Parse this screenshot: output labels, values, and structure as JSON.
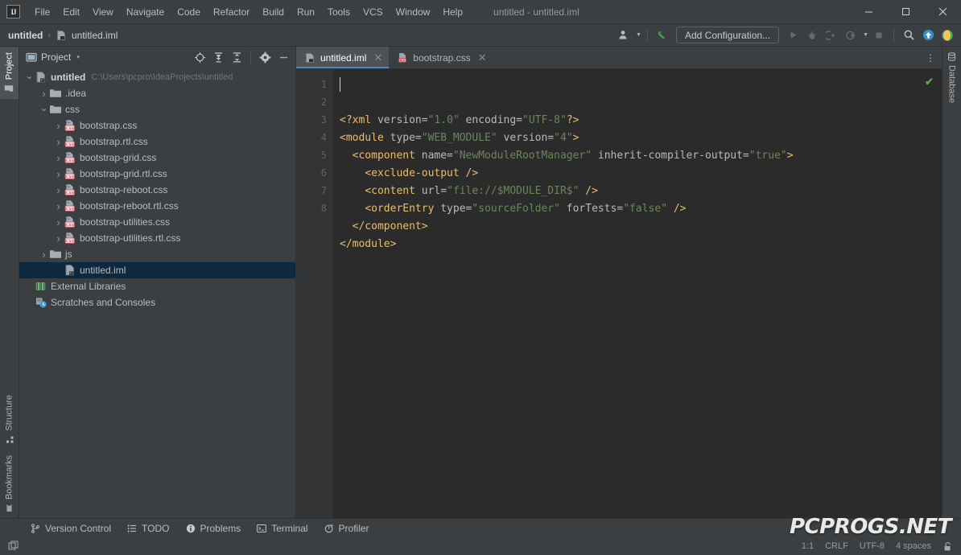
{
  "window": {
    "title": "untitled - untitled.iml",
    "minimize_label": "─",
    "maximize_label": "☐",
    "close_label": "✕"
  },
  "menu": {
    "logo": "IJ",
    "items": [
      {
        "label": "File"
      },
      {
        "label": "Edit"
      },
      {
        "label": "View"
      },
      {
        "label": "Navigate"
      },
      {
        "label": "Code"
      },
      {
        "label": "Refactor"
      },
      {
        "label": "Build"
      },
      {
        "label": "Run"
      },
      {
        "label": "Tools"
      },
      {
        "label": "VCS"
      },
      {
        "label": "Window"
      },
      {
        "label": "Help"
      }
    ]
  },
  "navbar": {
    "breadcrumb": [
      {
        "label": "untitled"
      },
      {
        "label": "untitled.iml"
      }
    ],
    "separator": "›",
    "add_configuration": "Add Configuration...",
    "icons": [
      "user-avatar-icon",
      "chevron-down-icon",
      "vcs-update-arrow-icon",
      "run-icon",
      "debug-icon",
      "run-coverage-icon",
      "profile-icon",
      "chevron-down-icon",
      "stop-icon",
      "search-icon",
      "update-icon",
      "ide-feature-icon"
    ]
  },
  "left_strip": {
    "tabs": [
      {
        "label": "Project",
        "icon": "project-folder-icon",
        "active": true
      },
      {
        "label": "Structure",
        "icon": "structure-icon",
        "active": false
      },
      {
        "label": "Bookmarks",
        "icon": "bookmarks-icon",
        "active": false
      }
    ],
    "bottom_icon": "layout-windows-icon"
  },
  "right_strip": {
    "tabs": [
      {
        "label": "Database",
        "icon": "database-icon",
        "active": false
      }
    ]
  },
  "project_panel": {
    "title": "Project",
    "title_caret": "▾",
    "toolbar_icons": [
      "locate-target-icon",
      "expand-all-icon",
      "collapse-all-icon",
      "settings-gear-icon",
      "minimize-icon"
    ],
    "tree": [
      {
        "indent": 0,
        "arrow": "down",
        "icon": "module-icon",
        "label": "untitled",
        "bold": true,
        "path": "C:\\Users\\pcpro\\IdeaProjects\\untitled",
        "selected": false
      },
      {
        "indent": 1,
        "arrow": "right",
        "icon": "folder-icon",
        "label": ".idea",
        "bold": false,
        "path": "",
        "selected": false
      },
      {
        "indent": 1,
        "arrow": "down",
        "icon": "folder-icon",
        "label": "css",
        "bold": false,
        "path": "",
        "selected": false
      },
      {
        "indent": 2,
        "arrow": "right",
        "icon": "css-file-icon",
        "label": "bootstrap.css",
        "bold": false,
        "path": "",
        "selected": false
      },
      {
        "indent": 2,
        "arrow": "right",
        "icon": "css-file-icon",
        "label": "bootstrap.rtl.css",
        "bold": false,
        "path": "",
        "selected": false
      },
      {
        "indent": 2,
        "arrow": "right",
        "icon": "css-file-icon",
        "label": "bootstrap-grid.css",
        "bold": false,
        "path": "",
        "selected": false
      },
      {
        "indent": 2,
        "arrow": "right",
        "icon": "css-file-icon",
        "label": "bootstrap-grid.rtl.css",
        "bold": false,
        "path": "",
        "selected": false
      },
      {
        "indent": 2,
        "arrow": "right",
        "icon": "css-file-icon",
        "label": "bootstrap-reboot.css",
        "bold": false,
        "path": "",
        "selected": false
      },
      {
        "indent": 2,
        "arrow": "right",
        "icon": "css-file-icon",
        "label": "bootstrap-reboot.rtl.css",
        "bold": false,
        "path": "",
        "selected": false
      },
      {
        "indent": 2,
        "arrow": "right",
        "icon": "css-file-icon",
        "label": "bootstrap-utilities.css",
        "bold": false,
        "path": "",
        "selected": false
      },
      {
        "indent": 2,
        "arrow": "right",
        "icon": "css-file-icon",
        "label": "bootstrap-utilities.rtl.css",
        "bold": false,
        "path": "",
        "selected": false
      },
      {
        "indent": 1,
        "arrow": "right",
        "icon": "folder-icon",
        "label": "js",
        "bold": false,
        "path": "",
        "selected": false
      },
      {
        "indent": 2,
        "arrow": "none",
        "icon": "module-icon",
        "label": "untitled.iml",
        "bold": false,
        "path": "",
        "selected": true
      },
      {
        "indent": 0,
        "arrow": "none",
        "icon": "libraries-icon",
        "label": "External Libraries",
        "bold": false,
        "path": "",
        "selected": false
      },
      {
        "indent": 0,
        "arrow": "none",
        "icon": "scratches-icon",
        "label": "Scratches and Consoles",
        "bold": false,
        "path": "",
        "selected": false
      }
    ]
  },
  "editor": {
    "tabs": [
      {
        "label": "untitled.iml",
        "icon": "module-icon",
        "active": true,
        "close": "✕"
      },
      {
        "label": "bootstrap.css",
        "icon": "css-file-icon",
        "active": false,
        "close": "✕"
      }
    ],
    "more_icon": "⋮",
    "inspection_status": "✔",
    "line_numbers": [
      "1",
      "2",
      "3",
      "4",
      "5",
      "6",
      "7",
      "8"
    ],
    "lines": [
      [
        {
          "t": "pi",
          "s": "<?xml "
        },
        {
          "t": "attr",
          "s": "version="
        },
        {
          "t": "val",
          "s": "\"1.0\""
        },
        {
          "t": "attr",
          "s": " encoding="
        },
        {
          "t": "val",
          "s": "\"UTF-8\""
        },
        {
          "t": "pi",
          "s": "?>"
        }
      ],
      [
        {
          "t": "tag",
          "s": "<module "
        },
        {
          "t": "attr",
          "s": "type="
        },
        {
          "t": "val",
          "s": "\"WEB_MODULE\""
        },
        {
          "t": "attr",
          "s": " version="
        },
        {
          "t": "val",
          "s": "\"4\""
        },
        {
          "t": "tag",
          "s": ">"
        }
      ],
      [
        {
          "t": "txt",
          "s": "  "
        },
        {
          "t": "tag",
          "s": "<component "
        },
        {
          "t": "attr",
          "s": "name="
        },
        {
          "t": "val",
          "s": "\"NewModuleRootManager\""
        },
        {
          "t": "attr",
          "s": " inherit-compiler-output="
        },
        {
          "t": "val",
          "s": "\"true\""
        },
        {
          "t": "tag",
          "s": ">"
        }
      ],
      [
        {
          "t": "txt",
          "s": "    "
        },
        {
          "t": "tag",
          "s": "<exclude-output />"
        }
      ],
      [
        {
          "t": "txt",
          "s": "    "
        },
        {
          "t": "tag",
          "s": "<content "
        },
        {
          "t": "attr",
          "s": "url="
        },
        {
          "t": "val",
          "s": "\"file://$MODULE_DIR$\""
        },
        {
          "t": "tag",
          "s": " />"
        }
      ],
      [
        {
          "t": "txt",
          "s": "    "
        },
        {
          "t": "tag",
          "s": "<orderEntry "
        },
        {
          "t": "attr",
          "s": "type="
        },
        {
          "t": "val",
          "s": "\"sourceFolder\""
        },
        {
          "t": "attr",
          "s": " forTests="
        },
        {
          "t": "val",
          "s": "\"false\""
        },
        {
          "t": "tag",
          "s": " />"
        }
      ],
      [
        {
          "t": "txt",
          "s": "  "
        },
        {
          "t": "tag",
          "s": "</component>"
        }
      ],
      [
        {
          "t": "tag",
          "s": "</module>"
        }
      ]
    ]
  },
  "bottom_bar": {
    "widgets": [
      {
        "label": "Version Control",
        "icon": "branch-icon"
      },
      {
        "label": "TODO",
        "icon": "todo-list-icon"
      },
      {
        "label": "Problems",
        "icon": "problems-icon"
      },
      {
        "label": "Terminal",
        "icon": "terminal-icon"
      },
      {
        "label": "Profiler",
        "icon": "profiler-icon"
      }
    ]
  },
  "status_bar": {
    "caret_position": "1:1",
    "line_separator": "CRLF",
    "encoding": "UTF-8",
    "indent": "4 spaces",
    "lock_icon": "read-write-lock-icon"
  },
  "watermark": {
    "text": "PCPROGS.NET"
  },
  "colors": {
    "chrome": "#3c3f41",
    "editor_bg": "#2b2b2b",
    "gutter_bg": "#313335",
    "selection": "#0d293f",
    "tab_active": "#4e5254",
    "tab_underline": "#4a88c7",
    "text": "#bbbbbb",
    "code_text": "#a9b7c6",
    "tag": "#e8bf6a",
    "value": "#6a8759",
    "ok_green": "#62a346"
  }
}
